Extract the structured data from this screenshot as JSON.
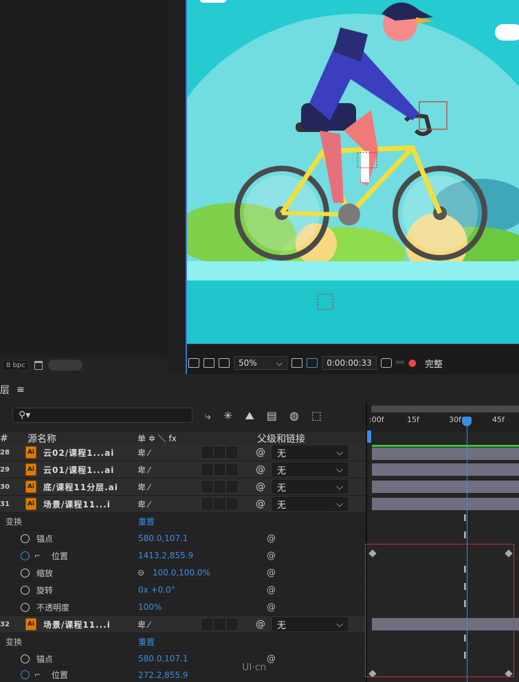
{
  "project": {
    "bpc_label": "8 bpc"
  },
  "viewer": {
    "zoom": "50%",
    "timecode": "0:00:00:33",
    "resolution": "完整"
  },
  "timeline": {
    "panel_title": "层",
    "menu_icon": "≡",
    "search_placeholder": "",
    "columns": {
      "num": "#",
      "source_name": "源名称",
      "switches": "单 ✲ ＼ fx",
      "parent": "父级和链接"
    },
    "ruler_ticks": [
      ":00f",
      "15f",
      "30f",
      "45f"
    ],
    "layers": [
      {
        "num": "28",
        "name": "云02/课程1...ai",
        "parent": "无"
      },
      {
        "num": "29",
        "name": "云01/课程1...ai",
        "parent": "无"
      },
      {
        "num": "30",
        "name": "底/课程11分层.ai",
        "parent": "无"
      },
      {
        "num": "31",
        "name": "场景/课程11...i",
        "parent": "无"
      }
    ],
    "transform_group1": {
      "label": "变换",
      "reset": "重置",
      "props": [
        {
          "name": "锚点",
          "value": "580.0,107.1"
        },
        {
          "name": "位置",
          "value": "1413.2,855.9"
        },
        {
          "name": "缩放",
          "value": "100.0,100.0%"
        },
        {
          "name": "旋转",
          "value": "0x +0.0°"
        },
        {
          "name": "不透明度",
          "value": "100%"
        }
      ]
    },
    "layer32": {
      "num": "32",
      "name": "场景/课程11...i",
      "parent": "无"
    },
    "transform_group2": {
      "label": "变换",
      "reset": "重置",
      "props": [
        {
          "name": "锚点",
          "value": "580.0,107.1"
        },
        {
          "name": "位置",
          "value": "272.2,855.9"
        }
      ]
    }
  },
  "watermark": "UI·cn",
  "colors": {
    "accent": "#3a8fe8",
    "highlight_box": "#d0312d",
    "ai_icon": "#e07b00"
  }
}
